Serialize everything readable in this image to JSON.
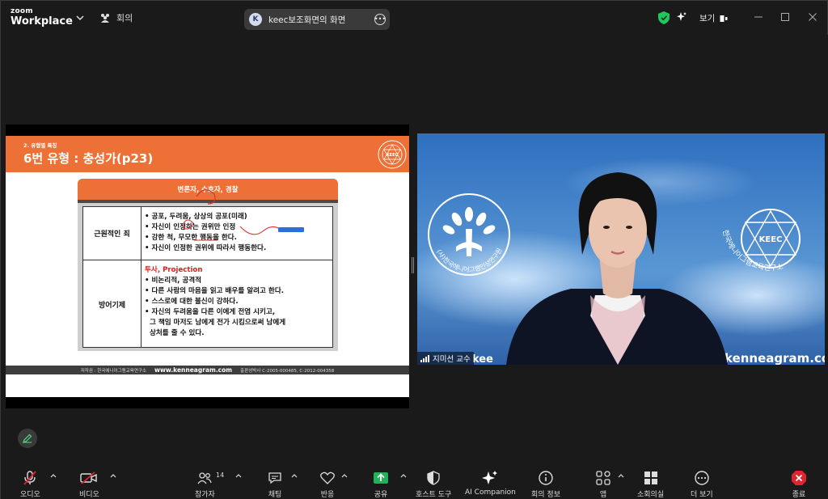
{
  "titlebar": {
    "brand_top": "zoom",
    "brand_bottom": "Workplace",
    "meeting_label": "회의",
    "share_avatar": "K",
    "share_title": "keec보조화면의 화면",
    "view_label": "보기"
  },
  "slide": {
    "category": "2. 유형별 특징",
    "title": "6번 유형 : 충성가(p23)",
    "subtitle": "변론자, 수호자, 경찰",
    "rows": [
      {
        "header": "근원적인 죄",
        "lines": [
          "• 공포, 두려움, 상상의 공포(미래)",
          "• 자신이 인정하는 권위만 인정",
          "• 강한 척, 무모한 행동을 한다.",
          "• 자신이 인정한 권위에 따라서 행동한다."
        ]
      },
      {
        "header": "방어기제",
        "highlight": "투사, Projection",
        "lines": [
          "• 비논리적, 공격적",
          "• 다른 사람의 마음을 읽고 배우를 알려고 한다.",
          "• 스스로에 대한 불신이 강하다.",
          "• 자신의 두려움을 다른 이에게 전염 시키고,",
          "  그 책임 마저도 남에게 전가 시킴으로써 남에게",
          "  상처를 줄 수 있다."
        ]
      }
    ],
    "footer_left": "저작권 : 한국에니어그램교육연구소",
    "footer_url": "www.kenneagram.com",
    "footer_right": "출판성박사 C-2005-000485, C-2012-004358",
    "logo_text": "KEEC"
  },
  "camera": {
    "participant_name": "지미선 교수",
    "bg_logo_left_ring": "(사)한국에니어그램인성연구원",
    "bg_logo_right": "KEEC",
    "bg_logo_right_ring": "한국에니어그램교육연구소",
    "bg_url": "kenneagram.com",
    "bg_keec_partial": "kee"
  },
  "toolbar": {
    "audio": "오디오",
    "video": "비디오",
    "participants": "참가자",
    "participants_count": "14",
    "chat": "채팅",
    "reactions": "반응",
    "share": "공유",
    "host_tools": "호스트 도구",
    "ai_companion": "AI Companion",
    "meeting_info": "회의 정보",
    "apps": "앱",
    "breakout": "소회의실",
    "more": "더 보기",
    "end": "종료"
  },
  "colors": {
    "slide_orange": "#ed7136",
    "share_green": "#20b15a",
    "end_red": "#e0242f",
    "shield_green": "#22c55e"
  }
}
